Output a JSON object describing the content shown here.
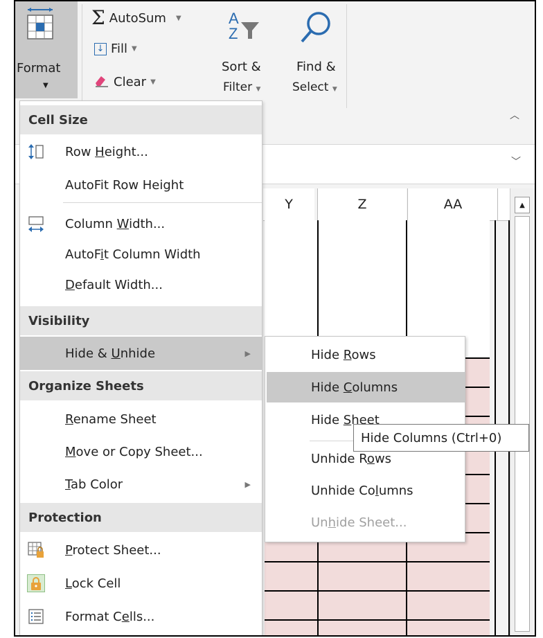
{
  "ribbon": {
    "format_label": "Format",
    "autosum_label": "AutoSum",
    "fill_label": "Fill",
    "clear_label": "Clear",
    "sort_filter_line1": "Sort &",
    "sort_filter_line2": "Filter",
    "find_select_line1": "Find &",
    "find_select_line2": "Select"
  },
  "columns": [
    "Y",
    "Z",
    "AA"
  ],
  "menu": {
    "sections": {
      "cell_size": "Cell Size",
      "visibility": "Visibility",
      "organize": "Organize Sheets",
      "protection": "Protection"
    },
    "items": {
      "row_height": {
        "pre": "Row ",
        "u": "H",
        "post": "eight..."
      },
      "autofit_row": {
        "pre": "AutoFit Row Height",
        "u": "",
        "post": ""
      },
      "column_width": {
        "pre": "Column ",
        "u": "W",
        "post": "idth..."
      },
      "autofit_column": {
        "pre": "AutoF",
        "u": "i",
        "post": "t Column Width"
      },
      "default_width": {
        "pre": "",
        "u": "D",
        "post": "efault Width..."
      },
      "hide_unhide": {
        "pre": "Hide & ",
        "u": "U",
        "post": "nhide"
      },
      "rename_sheet": {
        "pre": "",
        "u": "R",
        "post": "ename Sheet"
      },
      "move_copy": {
        "pre": "",
        "u": "M",
        "post": "ove or Copy Sheet..."
      },
      "tab_color": {
        "pre": "",
        "u": "T",
        "post": "ab Color"
      },
      "protect_sheet": {
        "pre": "",
        "u": "P",
        "post": "rotect Sheet..."
      },
      "lock_cell": {
        "pre": "",
        "u": "L",
        "post": "ock Cell"
      },
      "format_cells": {
        "pre": "Format C",
        "u": "e",
        "post": "lls..."
      }
    }
  },
  "submenu": {
    "hide_rows": {
      "pre": "Hide ",
      "u": "R",
      "post": "ows"
    },
    "hide_columns": {
      "pre": "Hide ",
      "u": "C",
      "post": "olumns"
    },
    "hide_sheet": {
      "pre": "Hide ",
      "u": "S",
      "post": "heet"
    },
    "unhide_rows": {
      "pre": "Unhide R",
      "u": "o",
      "post": "ws"
    },
    "unhide_columns": {
      "pre": "Unhide Co",
      "u": "l",
      "post": "umns"
    },
    "unhide_sheet": {
      "pre": "Un",
      "u": "h",
      "post": "ide Sheet..."
    }
  },
  "tooltip": "Hide Columns (Ctrl+0)",
  "colors": {
    "highlight": "#c9c9c9",
    "pink_cells": "#f2dcdb",
    "lock_icon": "#e8a23a"
  }
}
